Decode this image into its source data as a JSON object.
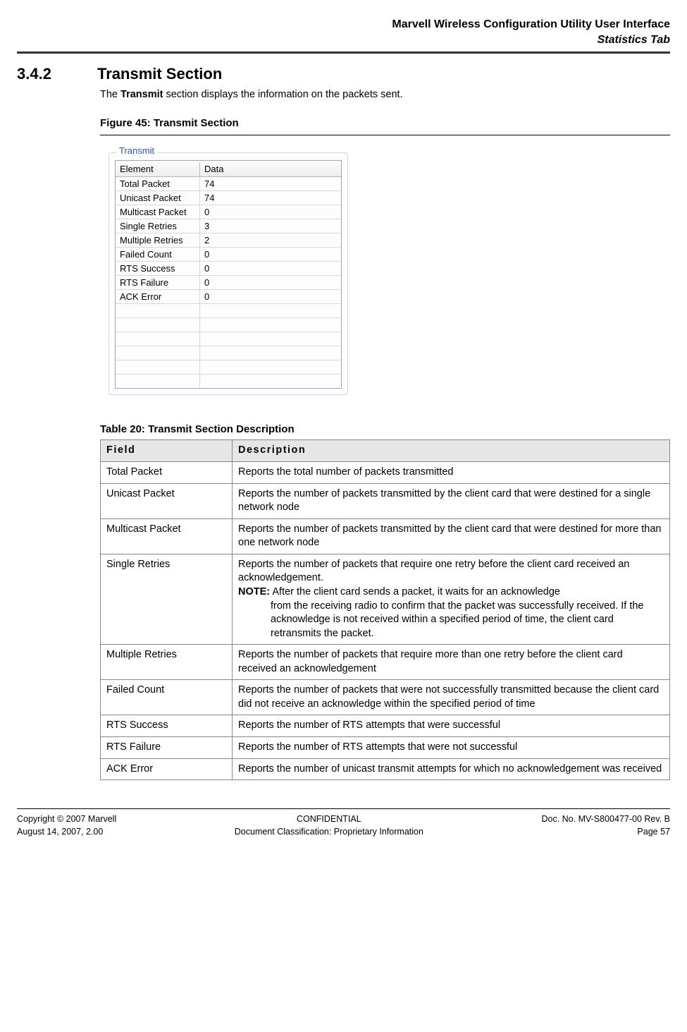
{
  "header": {
    "line1": "Marvell Wireless Configuration Utility User Interface",
    "line2": "Statistics Tab"
  },
  "section": {
    "number": "3.4.2",
    "title": "Transmit Section",
    "intro_pre": "The ",
    "intro_bold": "Transmit",
    "intro_post": " section displays the information on the packets sent."
  },
  "figure": {
    "caption": "Figure 45: Transmit Section",
    "legend": "Transmit",
    "headers": {
      "element": "Element",
      "data": "Data"
    },
    "rows": [
      {
        "element": "Total Packet",
        "data": "74"
      },
      {
        "element": "Unicast Packet",
        "data": "74"
      },
      {
        "element": "Multicast Packet",
        "data": "0"
      },
      {
        "element": "Single Retries",
        "data": "3"
      },
      {
        "element": "Multiple Retries",
        "data": "2"
      },
      {
        "element": "Failed Count",
        "data": "0"
      },
      {
        "element": "RTS Success",
        "data": "0"
      },
      {
        "element": "RTS Failure",
        "data": "0"
      },
      {
        "element": "ACK Error",
        "data": "0"
      }
    ],
    "blank_rows": 6
  },
  "table": {
    "caption": "Table 20:   Transmit Section Description",
    "headers": {
      "field": "Field",
      "description": "Description"
    },
    "rows": [
      {
        "field": "Total Packet",
        "desc": "Reports the total number of packets transmitted"
      },
      {
        "field": "Unicast Packet",
        "desc": "Reports the number of packets transmitted by the client card that were destined for a single network node"
      },
      {
        "field": "Multicast Packet",
        "desc": "Reports the number of packets transmitted by the client card that were destined for more than one network node"
      },
      {
        "field": "Single Retries",
        "desc": "Reports the number of packets that require one retry before the client card received an acknowledgement.",
        "note_label": "NOTE:",
        "note_first": " After the client card sends a packet, it waits for an acknowledge",
        "note_rest": "from the receiving radio to confirm that the packet was successfully received. If the acknowledge is not received within a specified period of time, the client card retransmits the packet."
      },
      {
        "field": "Multiple Retries",
        "desc": "Reports the number of packets that require more than one retry before the client card received an acknowledgement"
      },
      {
        "field": "Failed Count",
        "desc": "Reports the number of packets that were not successfully transmitted because the client card did not receive an acknowledge within the specified period of time"
      },
      {
        "field": "RTS Success",
        "desc": "Reports the number of RTS attempts that were successful"
      },
      {
        "field": "RTS Failure",
        "desc": "Reports the number of RTS attempts that were not successful"
      },
      {
        "field": "ACK Error",
        "desc": "Reports the number of unicast transmit attempts for which no acknowledgement was received"
      }
    ]
  },
  "footer": {
    "left1": "Copyright © 2007 Marvell",
    "left2": "August 14, 2007, 2.00",
    "center1": "CONFIDENTIAL",
    "center2": "Document Classification: Proprietary Information",
    "right1": "Doc. No. MV-S800477-00 Rev. B",
    "right2": "Page 57"
  }
}
